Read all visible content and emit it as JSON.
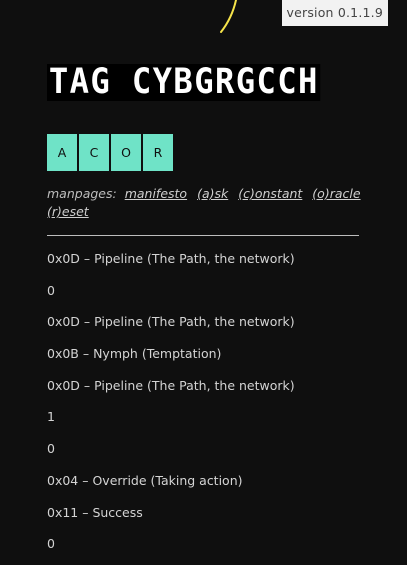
{
  "version": "version 0.1.1.9",
  "title": "TAG CYBGRGCCH",
  "buttons": [
    "A",
    "C",
    "O",
    "R"
  ],
  "manpages": {
    "label": "manpages:",
    "links": [
      "manifesto",
      "(a)sk",
      "(c)onstant",
      "(o)racle",
      "(r)eset"
    ]
  },
  "log": [
    "0x0D – Pipeline (The Path, the network)",
    "0",
    "0x0D – Pipeline (The Path, the network)",
    "0x0B – Nymph (Temptation)",
    "0x0D – Pipeline (The Path, the network)",
    "1",
    "0",
    "0x04 – Override (Taking action)",
    "0x11 – Success",
    "0"
  ],
  "colors": {
    "background": "#0f0f0f",
    "button": "#6fe3c7",
    "accent_arc": "#f5e34a"
  }
}
